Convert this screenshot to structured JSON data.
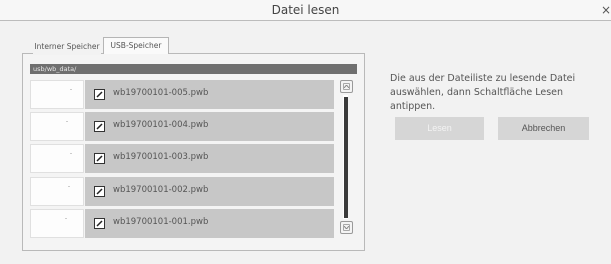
{
  "dialog": {
    "title": "Datei lesen",
    "close_glyph": "×"
  },
  "tabs": [
    {
      "label": "Interner Speicher",
      "active": false
    },
    {
      "label": "USB-Speicher",
      "active": true
    }
  ],
  "path": "usb/wb_data/",
  "files": [
    {
      "name": "wb19700101-005.pwb",
      "icon": "edit-icon"
    },
    {
      "name": "wb19700101-004.pwb",
      "icon": "edit-icon"
    },
    {
      "name": "wb19700101-003.pwb",
      "icon": "edit-icon"
    },
    {
      "name": "wb19700101-002.pwb",
      "icon": "edit-icon"
    },
    {
      "name": "wb19700101-001.pwb",
      "icon": "edit-icon"
    }
  ],
  "scrollbar": {
    "up_icon": "chevron-up-icon",
    "down_icon": "chevron-down-icon"
  },
  "instruction": "Die aus der Dateiliste zu lesende Datei auswählen, dann Schaltfläche Lesen antippen.",
  "buttons": {
    "read": "Lesen",
    "read_enabled": false,
    "cancel": "Abbrechen"
  },
  "colors": {
    "row": "#c7c7c7",
    "path_bar": "#6f6f6f",
    "button": "#d6d6d6",
    "scroll_thumb": "#3a3a3a"
  }
}
